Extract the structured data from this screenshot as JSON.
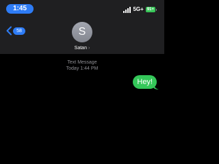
{
  "status_bar": {
    "time": "1:45",
    "network": "5G+",
    "battery": "91+",
    "time_pill_color": "#2e7cf6",
    "battery_color": "#39c759"
  },
  "nav": {
    "back_badge": "58",
    "back_icon": "chevron-left-icon"
  },
  "contact": {
    "initial": "S",
    "name": "Satan",
    "chevron": "›"
  },
  "conversation": {
    "service_label": "Text Message",
    "timestamp": "Today 1:44 PM",
    "messages": [
      {
        "text": "Hey!",
        "direction": "outgoing",
        "color": "#34c759"
      }
    ]
  }
}
